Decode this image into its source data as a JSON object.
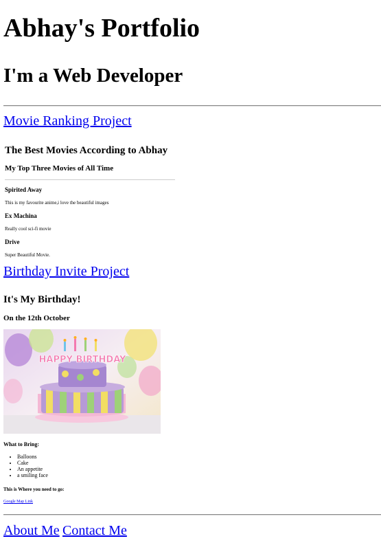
{
  "header": {
    "title": "Abhay's Portfolio",
    "subtitle": "I'm a Web Developer"
  },
  "projects": {
    "movie_link": "Movie Ranking Project",
    "birthday_link": "Birthday Invite Project"
  },
  "movie_page": {
    "title": "The Best Movies According to Abhay",
    "subtitle": "My Top Three Movies of All Time",
    "movies": [
      {
        "name": "Spirited Away",
        "desc": "This is my favourite anime,i love the beautiful images"
      },
      {
        "name": "Ex Machina",
        "desc": "Really cool sci-fi movie"
      },
      {
        "name": "Drive",
        "desc": "Super Beautiful Movie."
      }
    ]
  },
  "birthday_page": {
    "title": "It's My Birthday!",
    "date": "On the 12th October",
    "cake_text": "HAPPY BIRTHDAY",
    "bring_label": "What to Bring:",
    "bring_items": [
      "Balloons",
      "Cake",
      "An appetite",
      "a smiling face"
    ],
    "where_label": "This is Where you need to go:",
    "map_link": "Google Map Link"
  },
  "footer": {
    "about": "About Me",
    "contact": "Contact Me"
  }
}
